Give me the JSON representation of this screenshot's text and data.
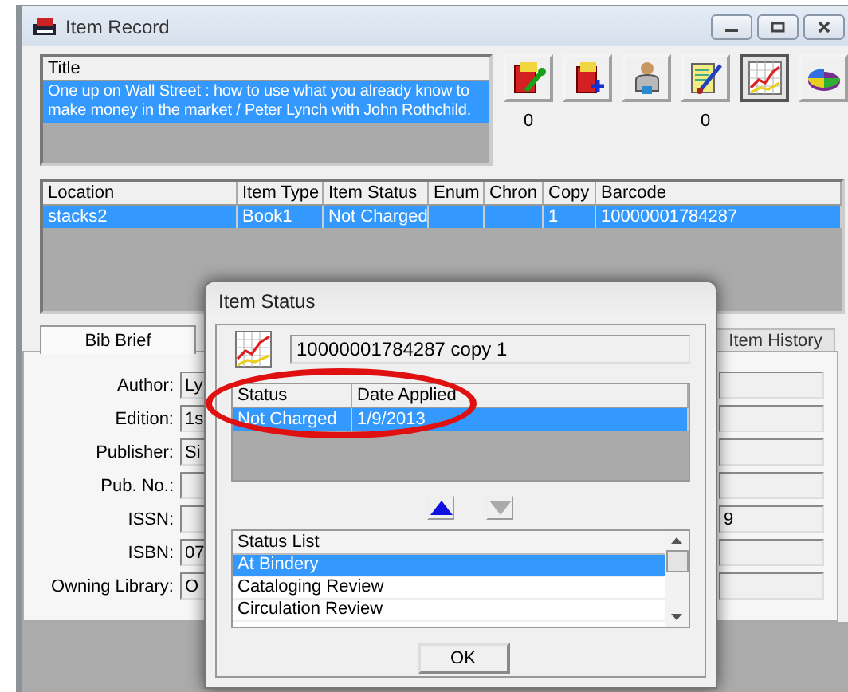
{
  "window": {
    "title": "Item Record"
  },
  "title_list": {
    "header": "Title",
    "rows": [
      {
        "text": "One up on Wall Street : how to use what you already know to make money in the market / Peter Lynch with John Rothchild.",
        "selected": true
      }
    ]
  },
  "toolbar": {
    "buttons": [
      {
        "kind": "book-wrench",
        "selected": false,
        "count": "0"
      },
      {
        "kind": "book-plus",
        "selected": false
      },
      {
        "kind": "person",
        "selected": false
      },
      {
        "kind": "document-pen",
        "selected": false,
        "count": "0"
      },
      {
        "kind": "chart",
        "selected": true
      },
      {
        "kind": "pie",
        "selected": false
      }
    ]
  },
  "items_table": {
    "columns": [
      "Location",
      "Item Type",
      "Item Status",
      "Enum",
      "Chron",
      "Copy",
      "Barcode"
    ],
    "rows": [
      {
        "cells": [
          "stacks2",
          "Book1",
          "Not Charged",
          "",
          "",
          "1",
          "10000001784287"
        ],
        "selected": true
      }
    ]
  },
  "tabs": [
    {
      "label": "Bib Brief",
      "selected": true
    },
    {
      "label": "Item History",
      "selected": false
    }
  ],
  "bib_fields": [
    {
      "label": "Author:",
      "value": "Ly"
    },
    {
      "label": "Edition:",
      "value": "1s"
    },
    {
      "label": "Publisher:",
      "value": "Si"
    },
    {
      "label": "Pub. No.:"
    },
    {
      "label": "ISSN:",
      "right_value": "9"
    },
    {
      "label": "ISBN:",
      "value": "07"
    },
    {
      "label": "Owning Library:",
      "value": "O"
    }
  ],
  "dialog": {
    "title": "Item Status",
    "barcode_field": "10000001784287 copy 1",
    "status_table": {
      "columns": [
        "Status",
        "Date Applied"
      ],
      "rows": [
        {
          "cells": [
            "Not Charged",
            "1/9/2013"
          ],
          "selected": true
        }
      ]
    },
    "move_buttons": [
      {
        "kind": "up",
        "disabled": false
      },
      {
        "kind": "down",
        "disabled": true
      }
    ],
    "status_list": {
      "header": "Status List",
      "items": [
        {
          "label": "At Bindery",
          "selected": true
        },
        {
          "label": "Cataloging Review",
          "selected": false
        },
        {
          "label": "Circulation Review",
          "selected": false
        }
      ]
    },
    "ok_button": "OK"
  }
}
